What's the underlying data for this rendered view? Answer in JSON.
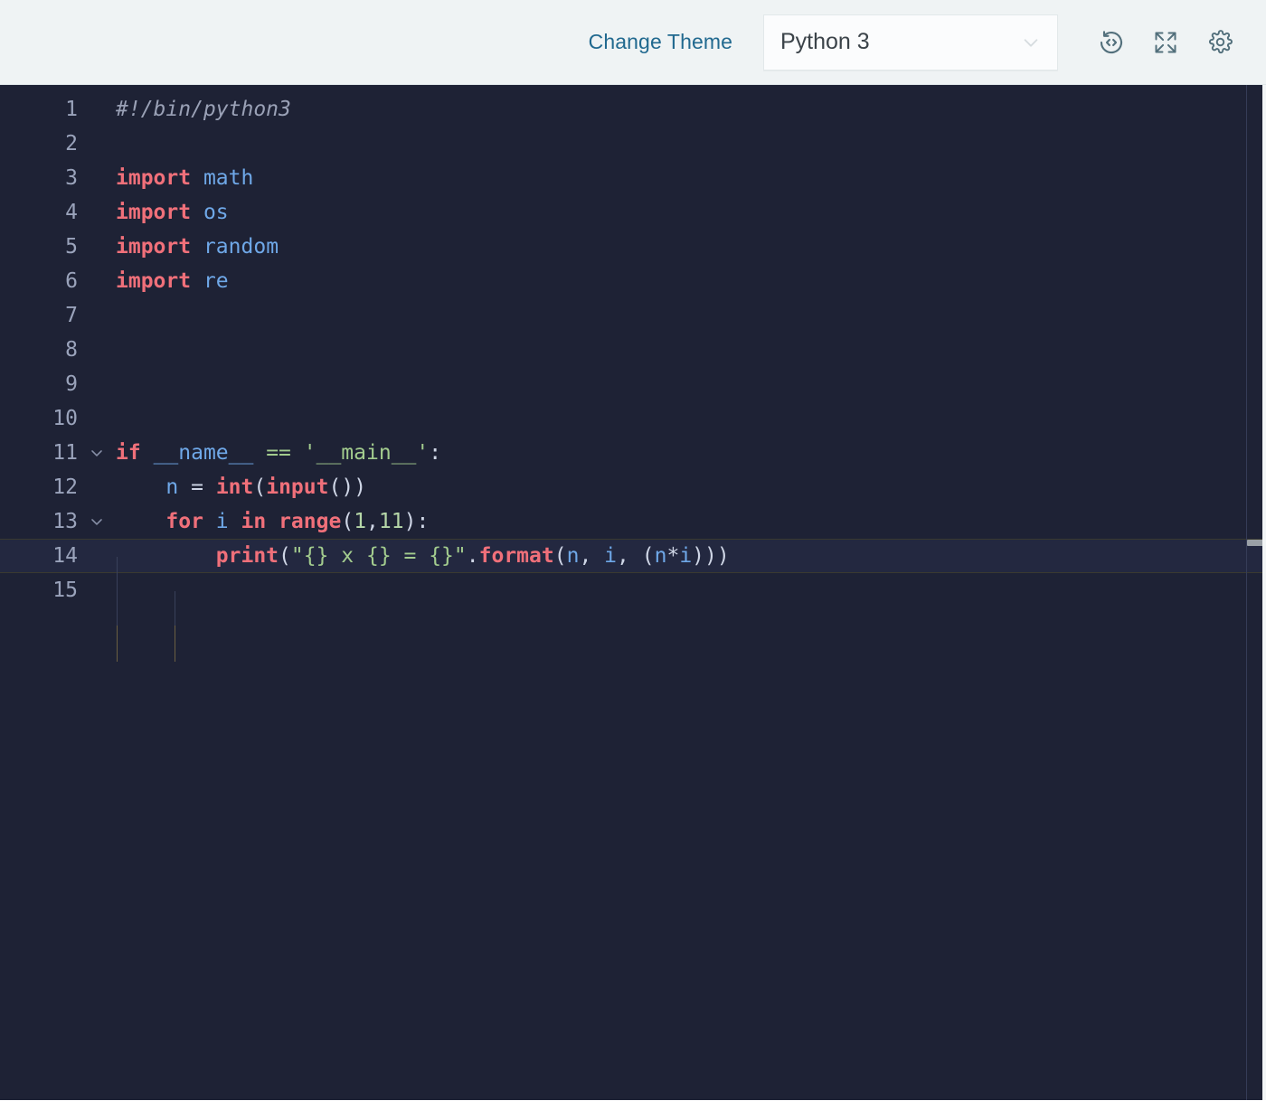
{
  "toolbar": {
    "change_theme_label": "Change Theme",
    "language_select": {
      "value": "Python 3",
      "options": [
        "Python 3"
      ],
      "chevron_icon": "chevron-down-icon"
    },
    "buttons": [
      {
        "name": "restore-code-button",
        "icon": "restore-code-icon",
        "title": "Restore original code"
      },
      {
        "name": "fullscreen-button",
        "icon": "fullscreen-expand-icon",
        "title": "Full screen"
      },
      {
        "name": "settings-button",
        "icon": "gear-icon",
        "title": "Settings"
      }
    ],
    "colors": {
      "background": "#eff3f4",
      "link": "#21698f",
      "icon": "#53707c"
    }
  },
  "editor": {
    "language": "Python 3",
    "colors": {
      "background": "#1e2235",
      "line_number": "#9aa3bb",
      "comment": "#9aa1b6",
      "keyword": "#f0707a",
      "variable": "#6fa8e8",
      "string": "#a3cc8e",
      "number": "#b6d7a8",
      "punctuation": "#cfd6e6",
      "active_line": "#232840",
      "indent_guide": "#39405a",
      "indent_guide_active": "#6b6042"
    },
    "active_line": 14,
    "total_lines": 15,
    "lines": [
      {
        "n": "1",
        "fold": "",
        "text": "#!/bin/python3"
      },
      {
        "n": "2",
        "fold": "",
        "text": ""
      },
      {
        "n": "3",
        "fold": "",
        "text": "import math"
      },
      {
        "n": "4",
        "fold": "",
        "text": "import os"
      },
      {
        "n": "5",
        "fold": "",
        "text": "import random"
      },
      {
        "n": "6",
        "fold": "",
        "text": "import re"
      },
      {
        "n": "7",
        "fold": "",
        "text": ""
      },
      {
        "n": "8",
        "fold": "",
        "text": ""
      },
      {
        "n": "9",
        "fold": "",
        "text": ""
      },
      {
        "n": "10",
        "fold": "",
        "text": ""
      },
      {
        "n": "11",
        "fold": "chevron-down-icon",
        "text": "if __name__ == '__main__':"
      },
      {
        "n": "12",
        "fold": "",
        "text": "    n = int(input())"
      },
      {
        "n": "13",
        "fold": "chevron-down-icon",
        "text": "    for i in range(1,11):"
      },
      {
        "n": "14",
        "fold": "",
        "text": "        print(\"{} x {} = {}\".format(n, i, (n*i)))"
      },
      {
        "n": "15",
        "fold": "",
        "text": ""
      }
    ]
  }
}
